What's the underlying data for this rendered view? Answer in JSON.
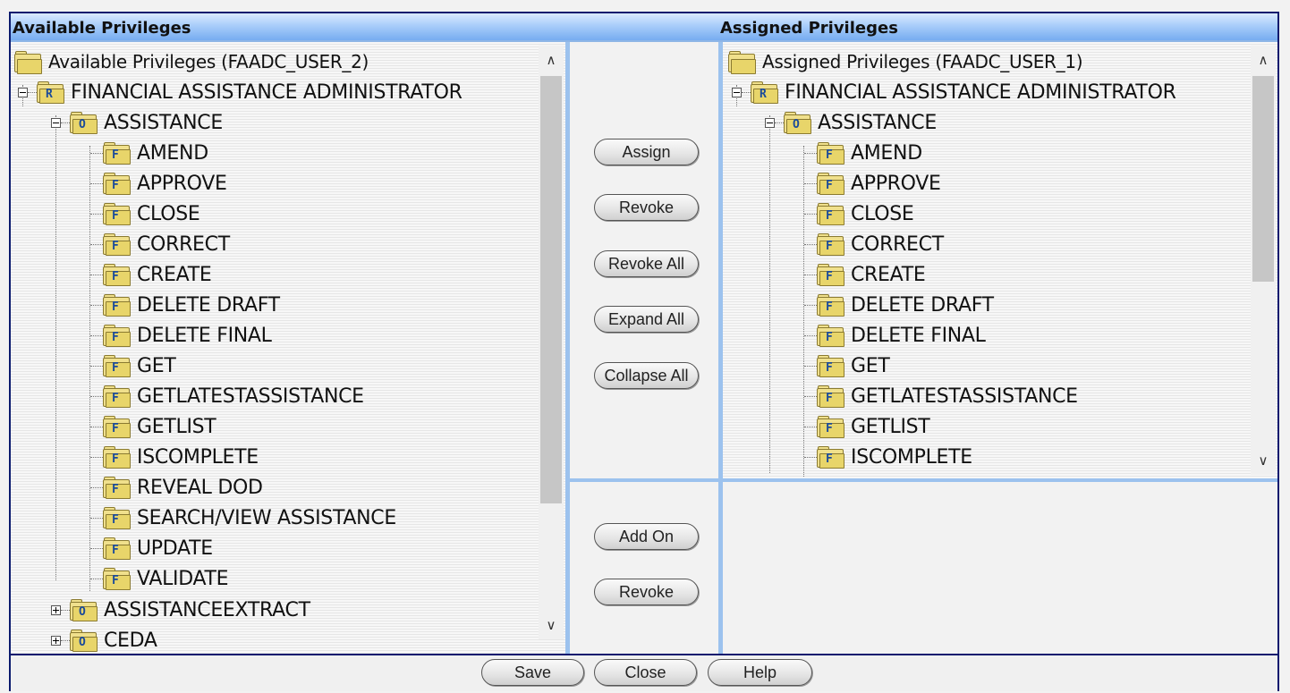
{
  "header": {
    "available_title": "Available Privileges",
    "assigned_title": "Assigned Privileges"
  },
  "available_tree": {
    "root_label": "Available Privileges (FAADC_USER_2)",
    "role": {
      "letter": "R",
      "label": "FINANCIAL ASSISTANCE ADMINISTRATOR"
    },
    "object": {
      "letter": "O",
      "label": "ASSISTANCE"
    },
    "functions": [
      {
        "letter": "F",
        "label": "AMEND"
      },
      {
        "letter": "F",
        "label": "APPROVE"
      },
      {
        "letter": "F",
        "label": "CLOSE"
      },
      {
        "letter": "F",
        "label": "CORRECT"
      },
      {
        "letter": "F",
        "label": "CREATE"
      },
      {
        "letter": "F",
        "label": "DELETE DRAFT"
      },
      {
        "letter": "F",
        "label": "DELETE FINAL"
      },
      {
        "letter": "F",
        "label": "GET"
      },
      {
        "letter": "F",
        "label": "GETLATESTASSISTANCE"
      },
      {
        "letter": "F",
        "label": "GETLIST"
      },
      {
        "letter": "F",
        "label": "ISCOMPLETE"
      },
      {
        "letter": "F",
        "label": "REVEAL DOD"
      },
      {
        "letter": "F",
        "label": "SEARCH/VIEW ASSISTANCE"
      },
      {
        "letter": "F",
        "label": "UPDATE"
      },
      {
        "letter": "F",
        "label": "VALIDATE"
      }
    ],
    "collapsed_objects": [
      {
        "letter": "O",
        "label": "ASSISTANCEEXTRACT"
      },
      {
        "letter": "O",
        "label": "CEDA"
      }
    ]
  },
  "assigned_tree": {
    "root_label": "Assigned Privileges (FAADC_USER_1)",
    "role": {
      "letter": "R",
      "label": "FINANCIAL ASSISTANCE ADMINISTRATOR"
    },
    "object": {
      "letter": "O",
      "label": "ASSISTANCE"
    },
    "functions": [
      {
        "letter": "F",
        "label": "AMEND"
      },
      {
        "letter": "F",
        "label": "APPROVE"
      },
      {
        "letter": "F",
        "label": "CLOSE"
      },
      {
        "letter": "F",
        "label": "CORRECT"
      },
      {
        "letter": "F",
        "label": "CREATE"
      },
      {
        "letter": "F",
        "label": "DELETE DRAFT"
      },
      {
        "letter": "F",
        "label": "DELETE FINAL"
      },
      {
        "letter": "F",
        "label": "GET"
      },
      {
        "letter": "F",
        "label": "GETLATESTASSISTANCE"
      },
      {
        "letter": "F",
        "label": "GETLIST"
      },
      {
        "letter": "F",
        "label": "ISCOMPLETE"
      }
    ]
  },
  "buttons": {
    "assign": "Assign",
    "revoke": "Revoke",
    "revoke_all": "Revoke All",
    "expand_all": "Expand All",
    "collapse_all": "Collapse All",
    "add_on": "Add On",
    "revoke_add_on": "Revoke"
  },
  "footer": {
    "save": "Save",
    "close": "Close",
    "help": "Help"
  },
  "icons": {
    "scroll_up": "∧",
    "scroll_down": "∨"
  },
  "colors": {
    "title_gradient_top": "#dbeaff",
    "title_gradient_bottom": "#76acf0",
    "divider": "#9cc2ee",
    "frame_border": "#0a1a6e",
    "folder_fill": "#e8d56a"
  }
}
